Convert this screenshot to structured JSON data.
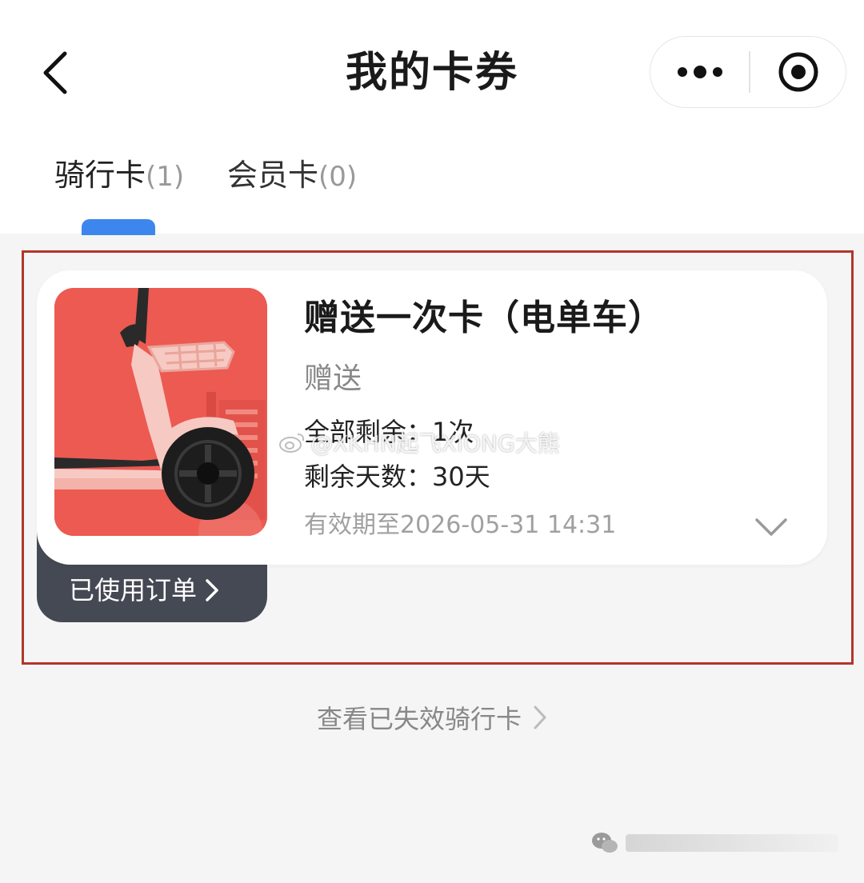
{
  "header": {
    "title": "我的卡券"
  },
  "tabs": [
    {
      "label": "骑行卡",
      "count": "(1)"
    },
    {
      "label": "会员卡",
      "count": "(0)"
    }
  ],
  "card": {
    "title": "赠送一次卡（电单车）",
    "subtitle": "赠送",
    "remaining": "全部剩余：1次",
    "days": "剩余天数：30天",
    "expiry": "有效期至2026-05-31 14:31",
    "used_orders": "已使用订单"
  },
  "footer": {
    "view_expired": "查看已失效骑行卡"
  },
  "watermark": {
    "text": "@XKHN起飞XIONG大熊"
  },
  "colors": {
    "accent": "#3d86ee",
    "highlight_border": "#b2362c",
    "card_image_bg": "#ec5a52",
    "used_orders_bg": "#454954"
  },
  "icons": [
    "back-arrow-icon",
    "more-dots-icon",
    "close-target-icon",
    "chevron-down-icon",
    "chevron-right-icon",
    "weibo-icon",
    "wechat-icon"
  ]
}
